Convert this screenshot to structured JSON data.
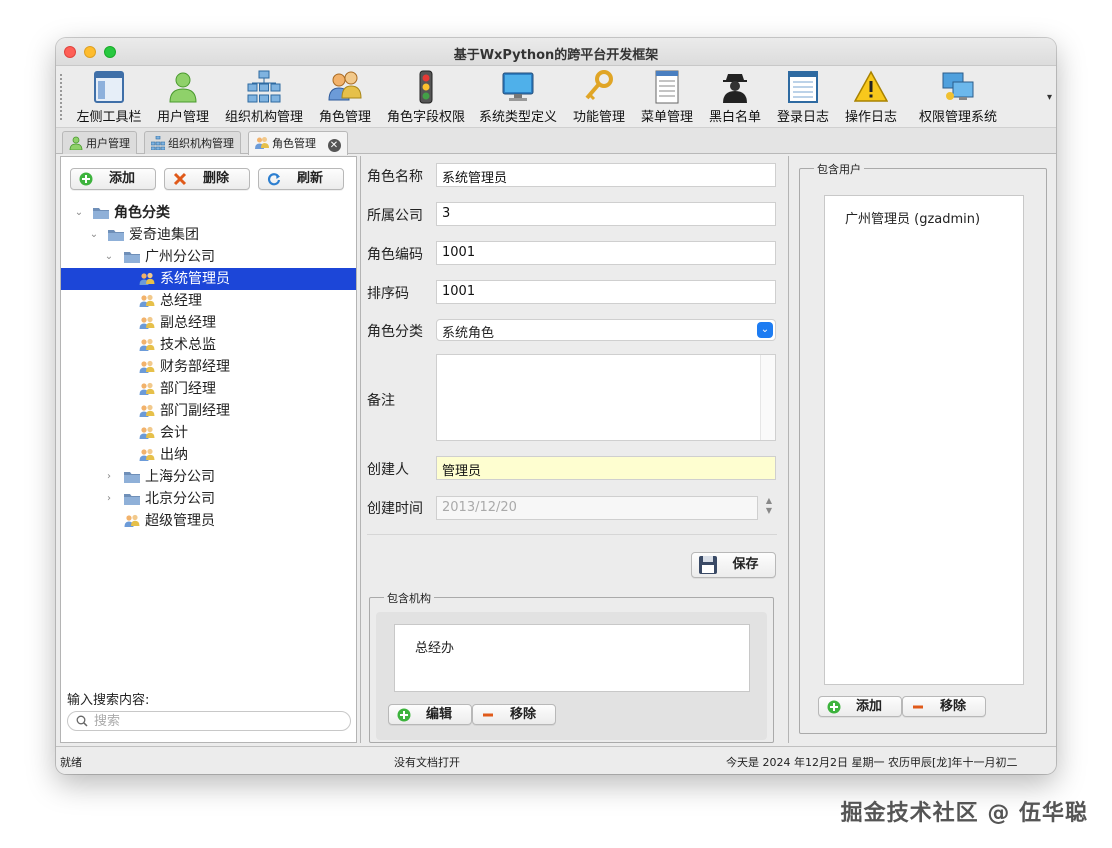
{
  "window": {
    "title": "基于WxPython的跨平台开发框架"
  },
  "toolbar": {
    "items": [
      {
        "label": "左侧工具栏",
        "icon": "window-icon"
      },
      {
        "label": "用户管理",
        "icon": "user-icon"
      },
      {
        "label": "组织机构管理",
        "icon": "org-chart-icon"
      },
      {
        "label": "角色管理",
        "icon": "role-icon"
      },
      {
        "label": "角色字段权限",
        "icon": "traffic-light-icon"
      },
      {
        "label": "系统类型定义",
        "icon": "monitor-icon"
      },
      {
        "label": "功能管理",
        "icon": "keys-icon"
      },
      {
        "label": "菜单管理",
        "icon": "menu-icon"
      },
      {
        "label": "黑白名单",
        "icon": "spy-icon"
      },
      {
        "label": "登录日志",
        "icon": "log-icon"
      },
      {
        "label": "操作日志",
        "icon": "warning-icon"
      },
      {
        "label": "权限管理系统",
        "icon": "computers-icon"
      }
    ]
  },
  "tabs": [
    {
      "label": "用户管理"
    },
    {
      "label": "组织机构管理"
    },
    {
      "label": "角色管理"
    }
  ],
  "left": {
    "buttons": {
      "add": "添加",
      "delete": "删除",
      "refresh": "刷新"
    },
    "tree": [
      {
        "label": "角色分类",
        "level": 0,
        "expanded": true,
        "type": "folder",
        "bold": true
      },
      {
        "label": "爱奇迪集团",
        "level": 1,
        "expanded": true,
        "type": "folder"
      },
      {
        "label": "广州分公司",
        "level": 2,
        "expanded": true,
        "type": "folder"
      },
      {
        "label": "系统管理员",
        "level": 3,
        "type": "role",
        "selected": true
      },
      {
        "label": "总经理",
        "level": 3,
        "type": "role"
      },
      {
        "label": "副总经理",
        "level": 3,
        "type": "role"
      },
      {
        "label": "技术总监",
        "level": 3,
        "type": "role"
      },
      {
        "label": "财务部经理",
        "level": 3,
        "type": "role"
      },
      {
        "label": "部门经理",
        "level": 3,
        "type": "role"
      },
      {
        "label": "部门副经理",
        "level": 3,
        "type": "role"
      },
      {
        "label": "会计",
        "level": 3,
        "type": "role"
      },
      {
        "label": "出纳",
        "level": 3,
        "type": "role"
      },
      {
        "label": "上海分公司",
        "level": 2,
        "expanded": false,
        "type": "folder"
      },
      {
        "label": "北京分公司",
        "level": 2,
        "expanded": false,
        "type": "folder"
      },
      {
        "label": "超级管理员",
        "level": 2,
        "type": "role"
      }
    ],
    "search": {
      "label": "输入搜索内容:",
      "placeholder": "搜索",
      "value": ""
    }
  },
  "form": {
    "role_name": {
      "label": "角色名称",
      "value": "系统管理员"
    },
    "company": {
      "label": "所属公司",
      "value": "3"
    },
    "role_code": {
      "label": "角色编码",
      "value": "1001"
    },
    "sort_code": {
      "label": "排序码",
      "value": "1001"
    },
    "category": {
      "label": "角色分类",
      "value": "系统角色"
    },
    "note": {
      "label": "备注",
      "value": ""
    },
    "creator": {
      "label": "创建人",
      "value": "管理员"
    },
    "created_time": {
      "label": "创建时间",
      "value": "2013/12/20"
    },
    "save_label": "保存"
  },
  "orgs": {
    "title": "包含机构",
    "items": [
      "总经办"
    ],
    "edit_label": "编辑",
    "remove_label": "移除"
  },
  "users": {
    "title": "包含用户",
    "items": [
      "广州管理员 (gzadmin)"
    ],
    "add_label": "添加",
    "remove_label": "移除"
  },
  "status": {
    "left": "就绪",
    "middle": "没有文档打开",
    "right": "今天是 2024 年12月2日 星期一 农历甲辰[龙]年十一月初二"
  },
  "watermark": "掘金技术社区 @ 伍华聪",
  "colors": {
    "selection": "#1c46d8",
    "creator_field": "#fefed0",
    "select_chevron": "#1d7cf2"
  }
}
